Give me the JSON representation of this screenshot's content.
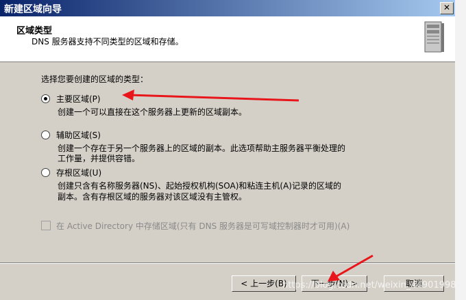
{
  "window": {
    "title": "新建区域向导",
    "close_label": "✕"
  },
  "header": {
    "title": "区域类型",
    "description": "DNS 服务器支持不同类型的区域和存储。"
  },
  "body": {
    "prompt": "选择您要创建的区域的类型：",
    "options": [
      {
        "label": "主要区域(P)",
        "desc": "创建一个可以直接在这个服务器上更新的区域副本。",
        "checked": true
      },
      {
        "label": "辅助区域(S)",
        "desc1": "创建一个存在于另一个服务器上的区域的副本。此选项帮助主服务器平衡处理的",
        "desc2": "工作量，并提供容错。",
        "checked": false
      },
      {
        "label": "存根区域(U)",
        "desc1": "创建只含有名称服务器(NS)、起始授权机构(SOA)和粘连主机(A)记录的区域的",
        "desc2": "副本。含有存根区域的服务器对该区域没有主管权。",
        "checked": false
      }
    ],
    "ad_checkbox_label": "在 Active Directory 中存储区域(只有 DNS 服务器是可写域控制器时才可用)(A)"
  },
  "footer": {
    "back": "< 上一步(B)",
    "next": "下一步(N) >",
    "cancel": "取消"
  },
  "watermark": "https://blog.csdn.net/weixin_44901998",
  "annotation_color": "#e8151b"
}
